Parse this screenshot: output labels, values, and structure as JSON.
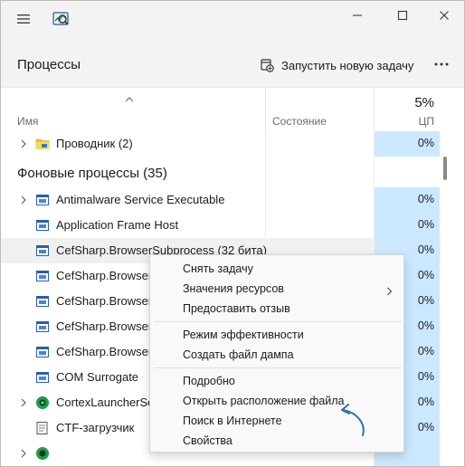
{
  "header": {
    "title": "Процессы",
    "run_task_label": "Запустить новую задачу"
  },
  "columns": {
    "name": "Имя",
    "state": "Состояние",
    "cpu_percent": "5%",
    "cpu_label": "ЦП"
  },
  "group": {
    "background_title": "Фоновые процессы (35)"
  },
  "rows": [
    {
      "name": "Проводник (2)",
      "cpu": "0%",
      "icon": "folder-icon",
      "expandable": true
    },
    {
      "name": "Antimalware Service Executable",
      "cpu": "0%",
      "icon": "app-window-icon",
      "expandable": true
    },
    {
      "name": "Application Frame Host",
      "cpu": "0%",
      "icon": "app-window-icon",
      "expandable": false
    },
    {
      "name": "CefSharp.BrowserSubprocess (32 бита)",
      "cpu": "0%",
      "icon": "app-window-icon",
      "expandable": false
    },
    {
      "name": "CefSharp.BrowserSu",
      "cpu": "0%",
      "icon": "app-window-icon",
      "expandable": false
    },
    {
      "name": "CefSharp.BrowserSu",
      "cpu": "0%",
      "icon": "app-window-icon",
      "expandable": false
    },
    {
      "name": "CefSharp.BrowserSu",
      "cpu": "0%",
      "icon": "app-window-icon",
      "expandable": false
    },
    {
      "name": "CefSharp.BrowserSu",
      "cpu": "0%",
      "icon": "app-window-icon",
      "expandable": false
    },
    {
      "name": "COM Surrogate",
      "cpu": "0%",
      "icon": "app-window-icon",
      "expandable": false
    },
    {
      "name": "CortexLauncherServ",
      "cpu": "0%",
      "icon": "cortex-icon",
      "expandable": true
    },
    {
      "name": "CTF-загрузчик",
      "cpu": "0%",
      "icon": "ctf-loader-icon",
      "expandable": false
    }
  ],
  "context_menu": {
    "items": [
      {
        "label": "Снять задачу"
      },
      {
        "label": "Значения ресурсов",
        "submenu": true
      },
      {
        "label": "Предоставить отзыв"
      },
      {
        "label": "Режим эффективности"
      },
      {
        "label": "Создать файл дампа"
      },
      {
        "label": "Подробно"
      },
      {
        "label": "Открыть расположение файла"
      },
      {
        "label": "Поиск в Интернете"
      },
      {
        "label": "Свойства"
      }
    ]
  },
  "colors": {
    "cpu_highlight": "#cce8ff",
    "annotation": "#2f6fb3",
    "titlebar_bg": "#f3f3f3"
  }
}
